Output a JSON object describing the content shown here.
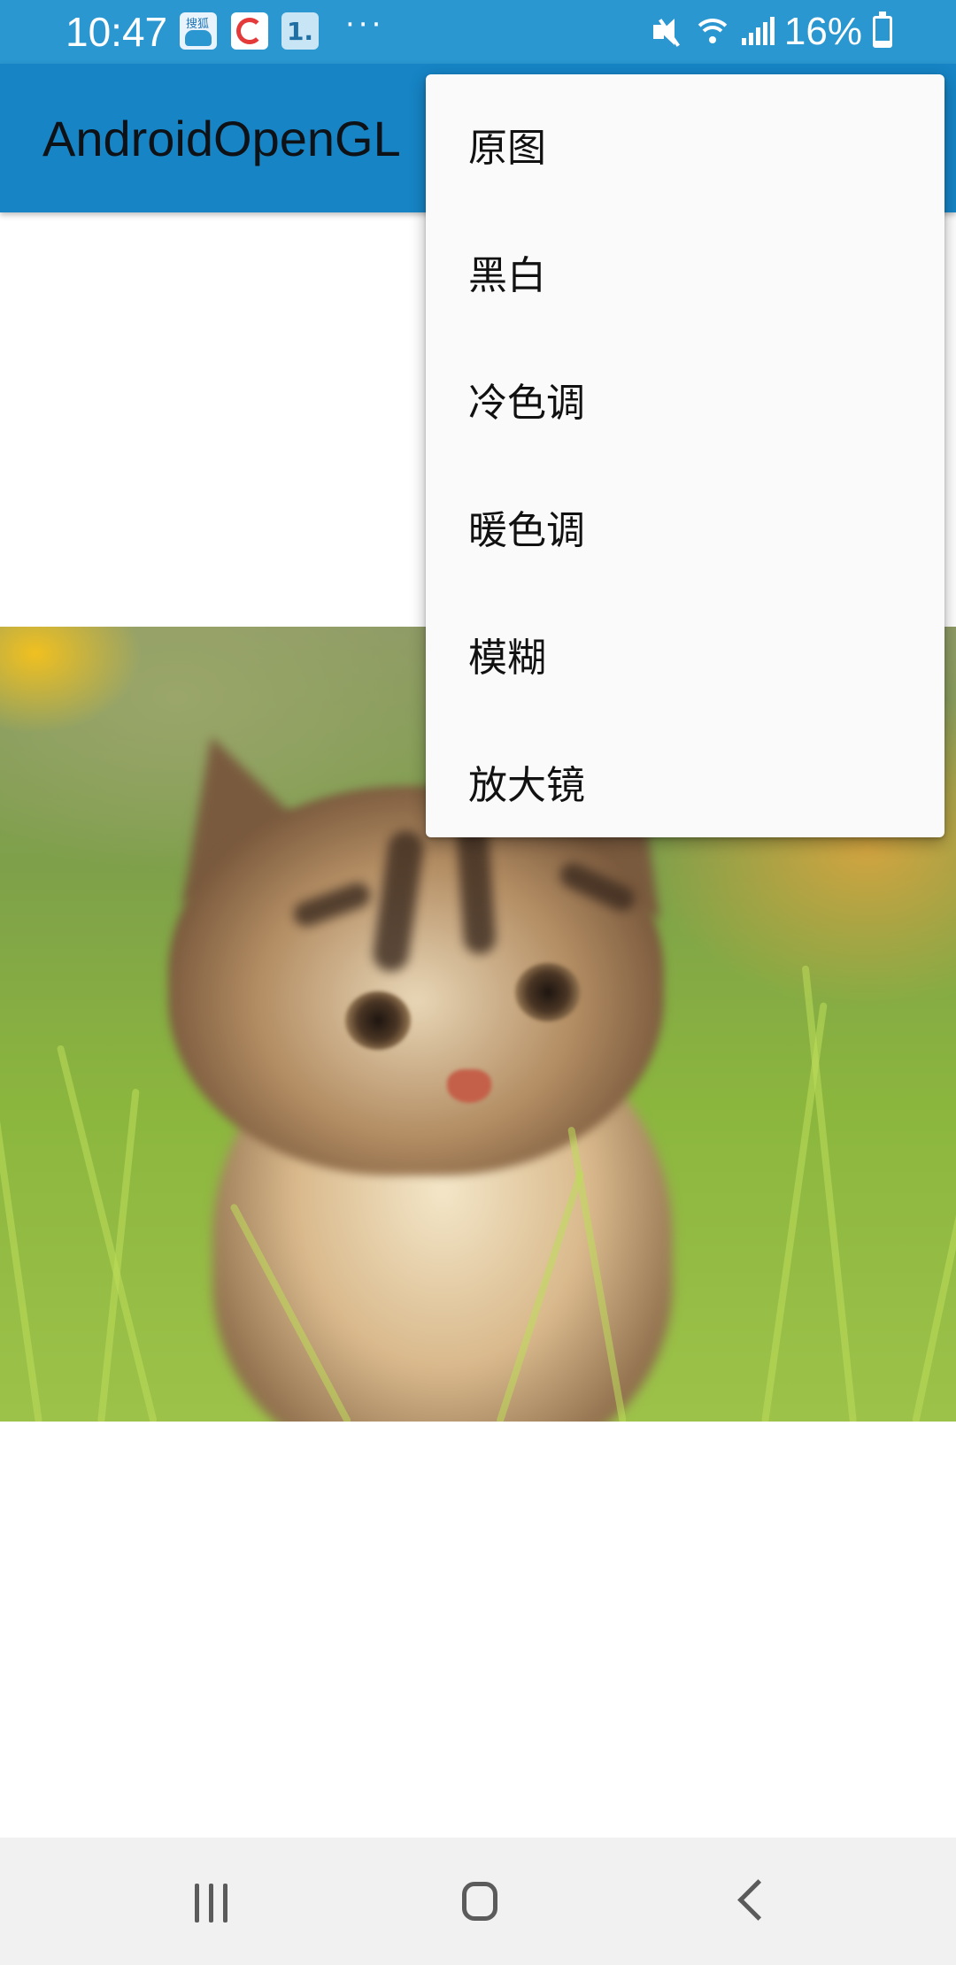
{
  "status_bar": {
    "time": "10:47",
    "notification_more": "···",
    "notif_badge": "1.",
    "battery": "16%"
  },
  "app_bar": {
    "title": "AndroidOpenGL"
  },
  "overflow_menu": {
    "items": [
      {
        "label": "原图"
      },
      {
        "label": "黑白"
      },
      {
        "label": "冷色调"
      },
      {
        "label": "暖色调"
      },
      {
        "label": "模糊"
      },
      {
        "label": "放大镜"
      }
    ]
  },
  "nav_bar": {
    "recents_icon": "recents-icon",
    "home_icon": "home-icon",
    "back_icon": "back-icon"
  },
  "colors": {
    "status_bar": "#2a97d0",
    "app_bar": "#1684c5",
    "menu_bg": "#fafafa",
    "nav_bg": "#f1f1f1"
  }
}
